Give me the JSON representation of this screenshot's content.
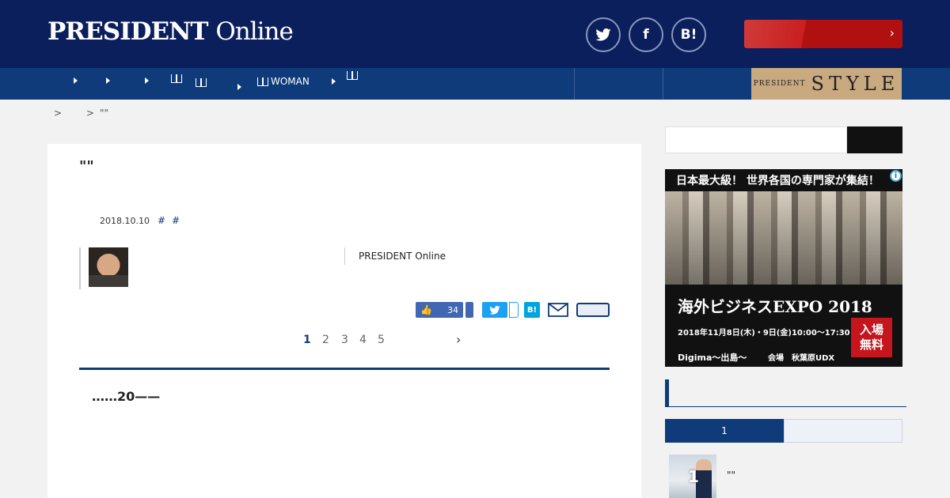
{
  "header": {
    "logo_bold": "PRESIDENT",
    "logo_light": "Online",
    "social": [
      {
        "label": "",
        "icon": "twitter-icon"
      },
      {
        "label": "f",
        "icon": "facebook-icon"
      },
      {
        "label": "B!",
        "icon": "hatena-icon"
      }
    ],
    "cta_label": "",
    "cta_chevron": "›"
  },
  "nav": {
    "items": [
      {
        "label": "",
        "icon": "book-icon"
      },
      {
        "label": "",
        "icon": "book-icon"
      },
      {
        "label": "WOMAN",
        "icon": "book-icon"
      }
    ],
    "style_banner": {
      "small": "PRESIDENT",
      "big": "STYLE"
    }
  },
  "breadcrumb": {
    "sep1": ">",
    "sep2": ">",
    "current": "\"\""
  },
  "article": {
    "title": "\"\"",
    "date": "2018.10.10",
    "tags": [
      "#",
      "#"
    ],
    "author_source": "PRESIDENT Online",
    "like_count": "34",
    "pages": [
      "1",
      "2",
      "3",
      "4",
      "5"
    ],
    "active_page": "1",
    "next": "›",
    "lead": "……20——"
  },
  "sidebar": {
    "ad": {
      "headline": "日本最大級！ 世界各国の専門家が集結！",
      "title": "海外ビジネスEXPO 2018",
      "date": "2018年11月8日(木)・9日(金)10:00～17:30",
      "brand": "Digima～出島～",
      "venue": "会場　秋葉原UDX",
      "badge_line1": "入場",
      "badge_line2": "無料",
      "info": "i"
    },
    "ranking": {
      "tabs": [
        "1",
        ""
      ],
      "items": [
        {
          "rank": "1",
          "title": "\"\""
        }
      ]
    }
  }
}
